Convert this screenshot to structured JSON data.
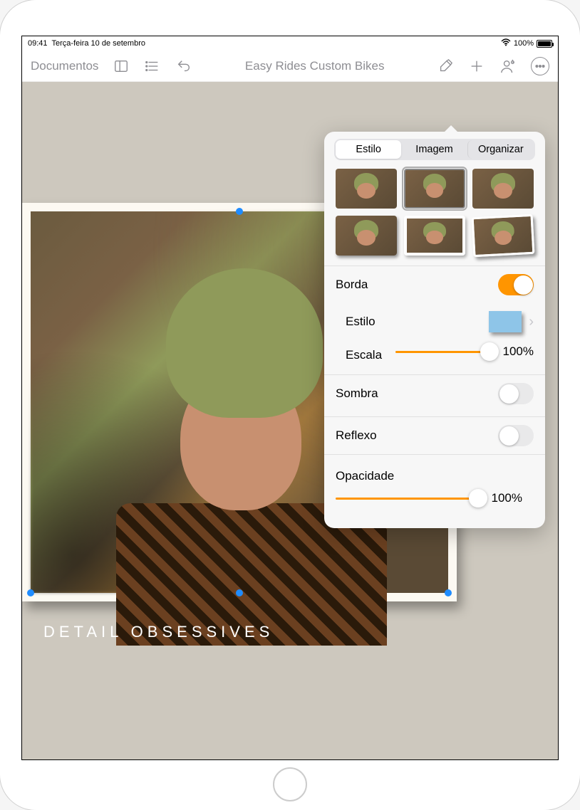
{
  "status": {
    "time": "09:41",
    "date": "Terça-feira 10 de setembro",
    "battery": "100%"
  },
  "toolbar": {
    "back": "Documentos",
    "title": "Easy Rides Custom Bikes"
  },
  "canvas": {
    "caption": "DETAIL OBSESSIVES"
  },
  "panel": {
    "tabs": {
      "style": "Estilo",
      "image": "Imagem",
      "arrange": "Organizar"
    },
    "border": {
      "label": "Borda",
      "on": true
    },
    "style_row": {
      "label": "Estilo"
    },
    "scale": {
      "label": "Escala",
      "value": 100,
      "display": "100%"
    },
    "shadow": {
      "label": "Sombra",
      "on": false
    },
    "reflection": {
      "label": "Reflexo",
      "on": false
    },
    "opacity": {
      "label": "Opacidade",
      "value": 100,
      "display": "100%"
    }
  }
}
